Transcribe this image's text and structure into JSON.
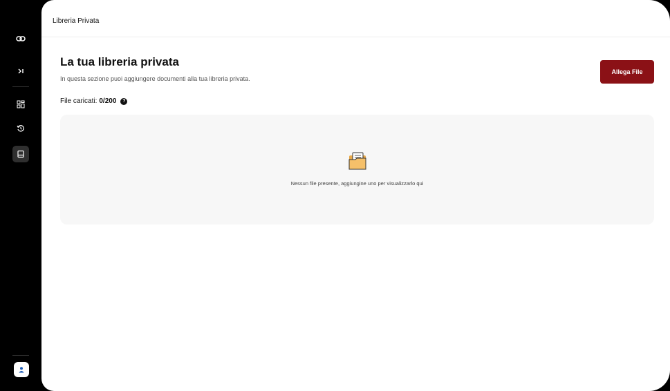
{
  "sidebar": {
    "items": [
      {
        "icon": "link-icon"
      },
      {
        "icon": "collapse-icon",
        "glyph": "›|"
      },
      {
        "icon": "dashboard-icon"
      },
      {
        "icon": "history-icon"
      },
      {
        "icon": "book-icon"
      }
    ],
    "user_icon": "user-icon"
  },
  "header": {
    "title": "Libreria Privata"
  },
  "main": {
    "title": "La tua libreria privata",
    "subtitle": "In questa sezione puoi aggiungere documenti alla tua libreria privata.",
    "files_label": "File caricati:",
    "files_count": "0/200",
    "help_icon": "?",
    "attach_button": "Allega File",
    "empty_message": "Nessun file presente, aggiungine uno per visualizzarlo qui"
  },
  "colors": {
    "accent": "#8b1116",
    "sidebar": "#000000",
    "panel": "#f7f7f7"
  }
}
